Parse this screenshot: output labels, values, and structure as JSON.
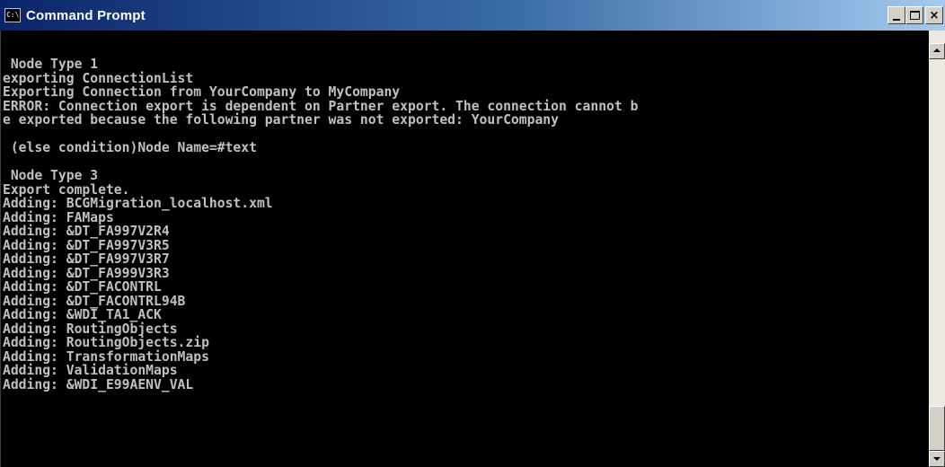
{
  "window": {
    "title": "Command Prompt",
    "icon_label": "C:\\",
    "buttons": {
      "minimize": "minimize-icon",
      "maximize": "maximize-icon",
      "close": "×"
    }
  },
  "console": {
    "lines": [
      " Node Type 1",
      "exporting ConnectionList",
      "Exporting Connection from YourCompany to MyCompany",
      "ERROR: Connection export is dependent on Partner export. The connection cannot b",
      "e exported because the following partner was not exported: YourCompany",
      "",
      " (else condition)Node Name=#text",
      "",
      " Node Type 3",
      "Export complete.",
      "Adding: BCGMigration_localhost.xml",
      "Adding: FAMaps",
      "Adding: &DT_FA997V2R4",
      "Adding: &DT_FA997V3R5",
      "Adding: &DT_FA997V3R7",
      "Adding: &DT_FA999V3R3",
      "Adding: &DT_FACONTRL",
      "Adding: &DT_FACONTRL94B",
      "Adding: &WDI_TA1_ACK",
      "Adding: RoutingObjects",
      "Adding: RoutingObjects.zip",
      "Adding: TransformationMaps",
      "Adding: ValidationMaps",
      "Adding: &WDI_E99AENV_VAL"
    ]
  },
  "colors": {
    "console_background": "#000000",
    "console_text": "#c0c0c0",
    "titlebar_start": "#0a246a",
    "titlebar_end": "#a6caf0"
  }
}
